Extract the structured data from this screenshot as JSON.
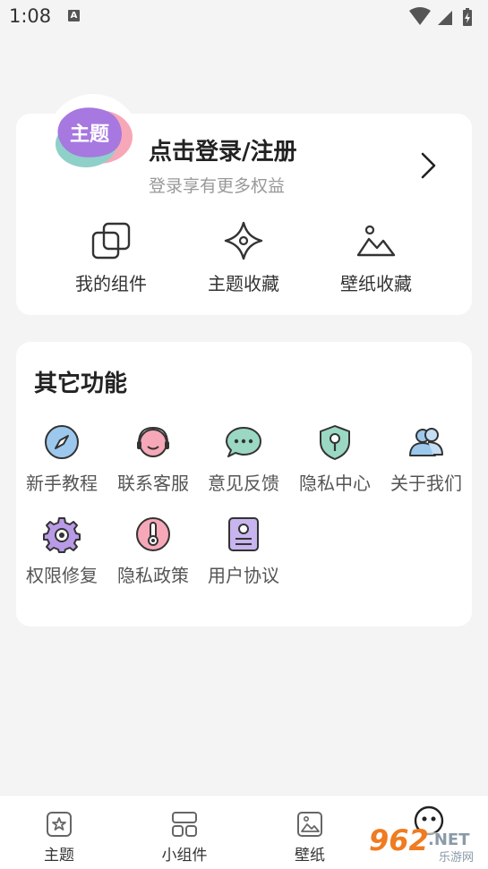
{
  "status_bar": {
    "time": "1:08",
    "notification_letter": "A"
  },
  "login": {
    "avatar_text": "主题",
    "title": "点击登录/注册",
    "subtitle": "登录享有更多权益"
  },
  "quick_actions": [
    {
      "label": "我的组件",
      "icon": "widgets-icon"
    },
    {
      "label": "主题收藏",
      "icon": "star-favorite-icon"
    },
    {
      "label": "壁纸收藏",
      "icon": "image-icon"
    }
  ],
  "other_functions": {
    "title": "其它功能",
    "items": [
      {
        "label": "新手教程",
        "icon": "compass-icon"
      },
      {
        "label": "联系客服",
        "icon": "customer-service-icon"
      },
      {
        "label": "意见反馈",
        "icon": "chat-bubble-icon"
      },
      {
        "label": "隐私中心",
        "icon": "shield-key-icon"
      },
      {
        "label": "关于我们",
        "icon": "people-icon"
      },
      {
        "label": "权限修复",
        "icon": "gear-icon"
      },
      {
        "label": "隐私政策",
        "icon": "thermometer-icon"
      },
      {
        "label": "用户协议",
        "icon": "document-icon"
      }
    ]
  },
  "tab_bar": {
    "tabs": [
      {
        "label": "主题",
        "icon": "theme-star-icon"
      },
      {
        "label": "小组件",
        "icon": "widget-grid-icon"
      },
      {
        "label": "壁纸",
        "icon": "wallpaper-icon"
      },
      {
        "label": "",
        "icon": "mine-face-icon"
      }
    ]
  },
  "watermark": {
    "number": "962",
    "suffix": ".NET",
    "sub": "乐游网"
  },
  "colors": {
    "accent_purple": "#a678e0",
    "teal": "#7cc7c0",
    "pink": "#f6a8b8",
    "blue": "#7fb2e6"
  }
}
